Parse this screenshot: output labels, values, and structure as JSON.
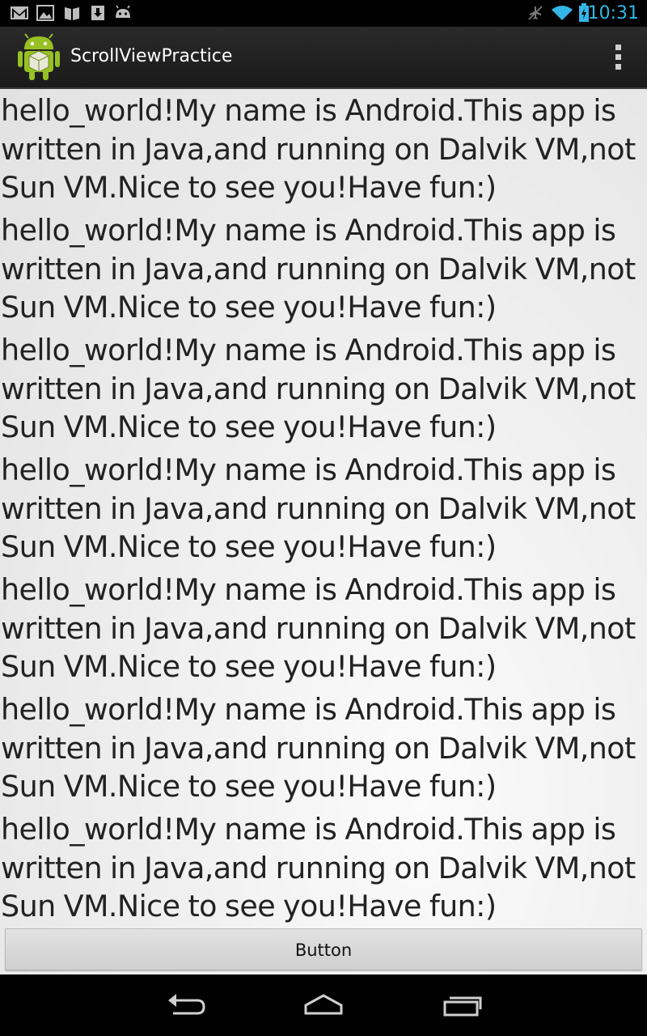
{
  "status_bar": {
    "time": "10:31",
    "left_icons": [
      "gmail-icon",
      "gallery-icon",
      "books-icon",
      "download-icon",
      "android-debug-icon"
    ],
    "right_icons": [
      "airplane-off-icon",
      "wifi-icon",
      "battery-charging-icon"
    ],
    "time_color": "#33b5e5"
  },
  "action_bar": {
    "title": "ScrollViewPractice",
    "icon": "android-app-icon",
    "overflow": "overflow-menu-icon"
  },
  "content": {
    "paragraphs": [
      "hello_world!My name is Android.This app is written in Java,and running on Dalvik VM,not Sun VM.Nice to see you!Have fun:)",
      "hello_world!My name is Android.This app is written in Java,and running on Dalvik VM,not Sun VM.Nice to see you!Have fun:)",
      "hello_world!My name is Android.This app is written in Java,and running on Dalvik VM,not Sun VM.Nice to see you!Have fun:)",
      "hello_world!My name is Android.This app is written in Java,and running on Dalvik VM,not Sun VM.Nice to see you!Have fun:)",
      "hello_world!My name is Android.This app is written in Java,and running on Dalvik VM,not Sun VM.Nice to see you!Have fun:)",
      "hello_world!My name is Android.This app is written in Java,and running on Dalvik VM,not Sun VM.Nice to see you!Have fun:)",
      "hello_world!My name is Android.This app is written in Java,and running on Dalvik VM,not Sun VM.Nice to see you!Have fun:)"
    ],
    "button_label": "Button"
  },
  "nav_bar": {
    "buttons": [
      "back-icon",
      "home-icon",
      "recent-apps-icon"
    ]
  }
}
